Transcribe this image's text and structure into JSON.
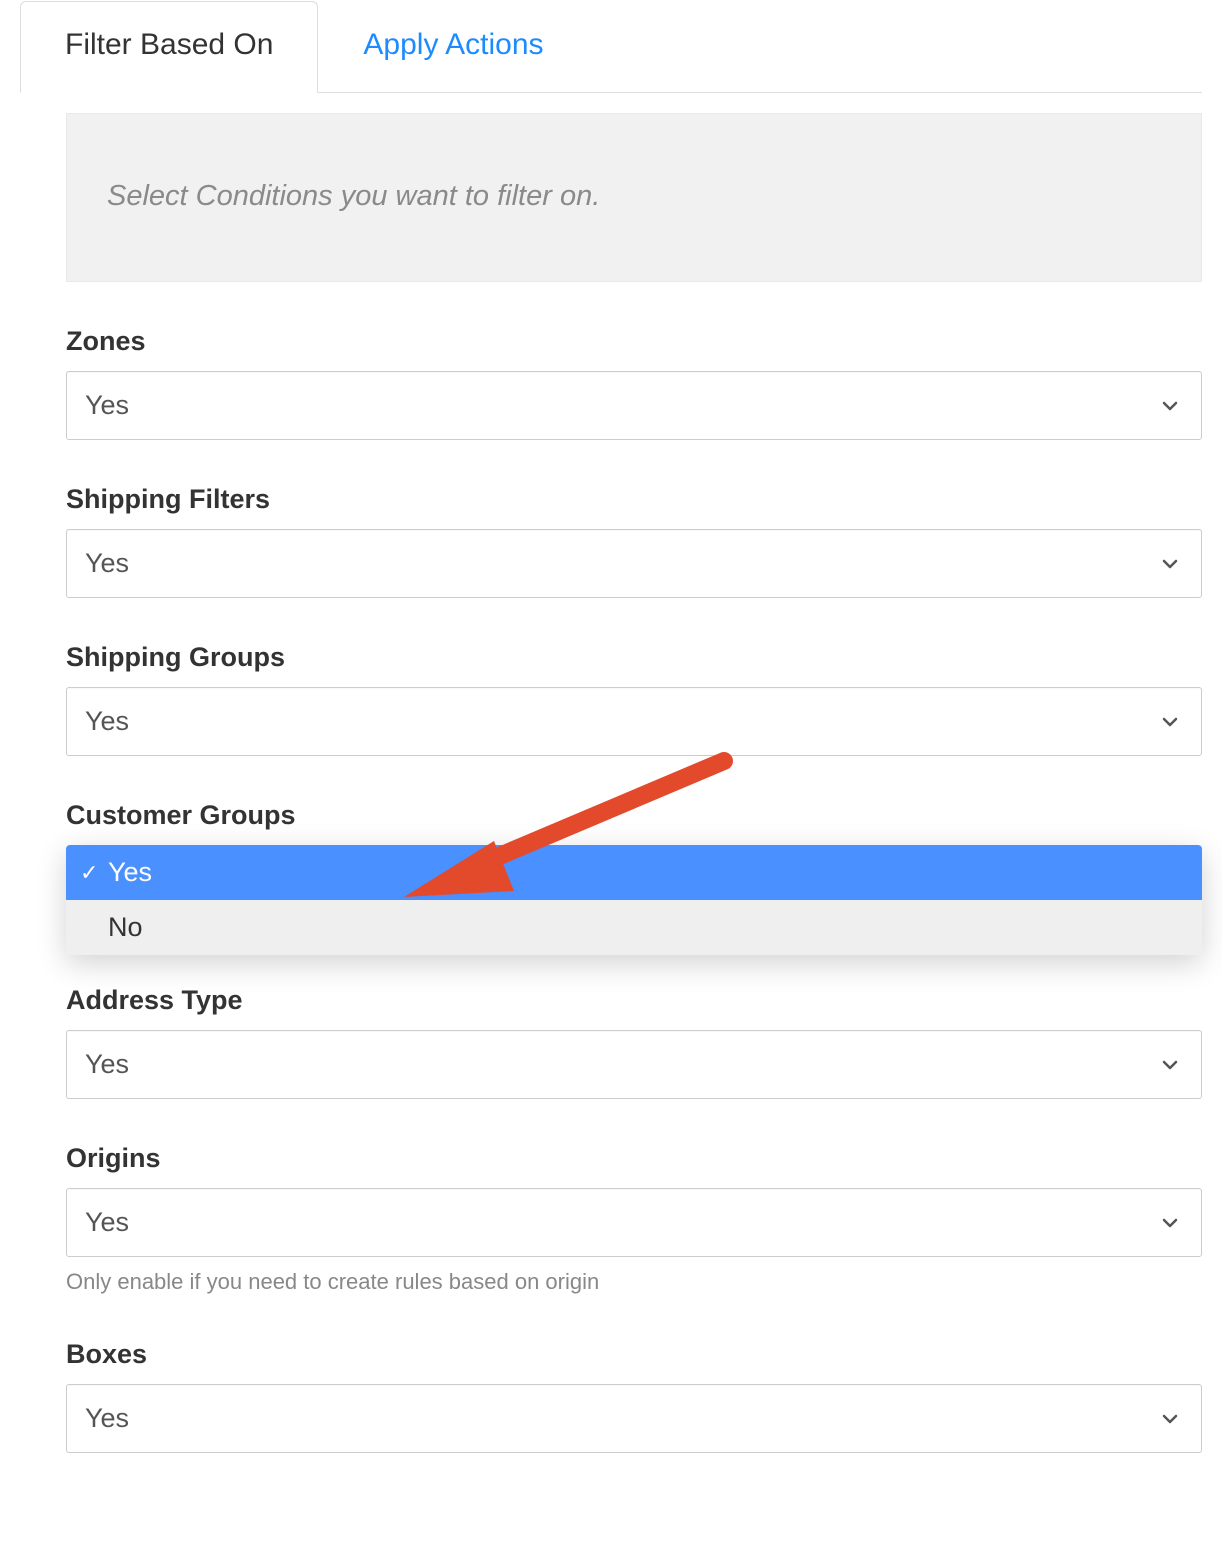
{
  "tabs": {
    "filter": "Filter Based On",
    "apply": "Apply Actions"
  },
  "infobox": "Select Conditions you want to filter on.",
  "fields": {
    "zones": {
      "label": "Zones",
      "value": "Yes"
    },
    "shipping_filters": {
      "label": "Shipping Filters",
      "value": "Yes"
    },
    "shipping_groups": {
      "label": "Shipping Groups",
      "value": "Yes"
    },
    "customer_groups": {
      "label": "Customer Groups",
      "options": {
        "yes": "Yes",
        "no": "No"
      }
    },
    "address_type": {
      "label": "Address Type",
      "value": "Yes"
    },
    "origins": {
      "label": "Origins",
      "value": "Yes",
      "helper": "Only enable if you need to create rules based on origin"
    },
    "boxes": {
      "label": "Boxes",
      "value": "Yes"
    }
  }
}
